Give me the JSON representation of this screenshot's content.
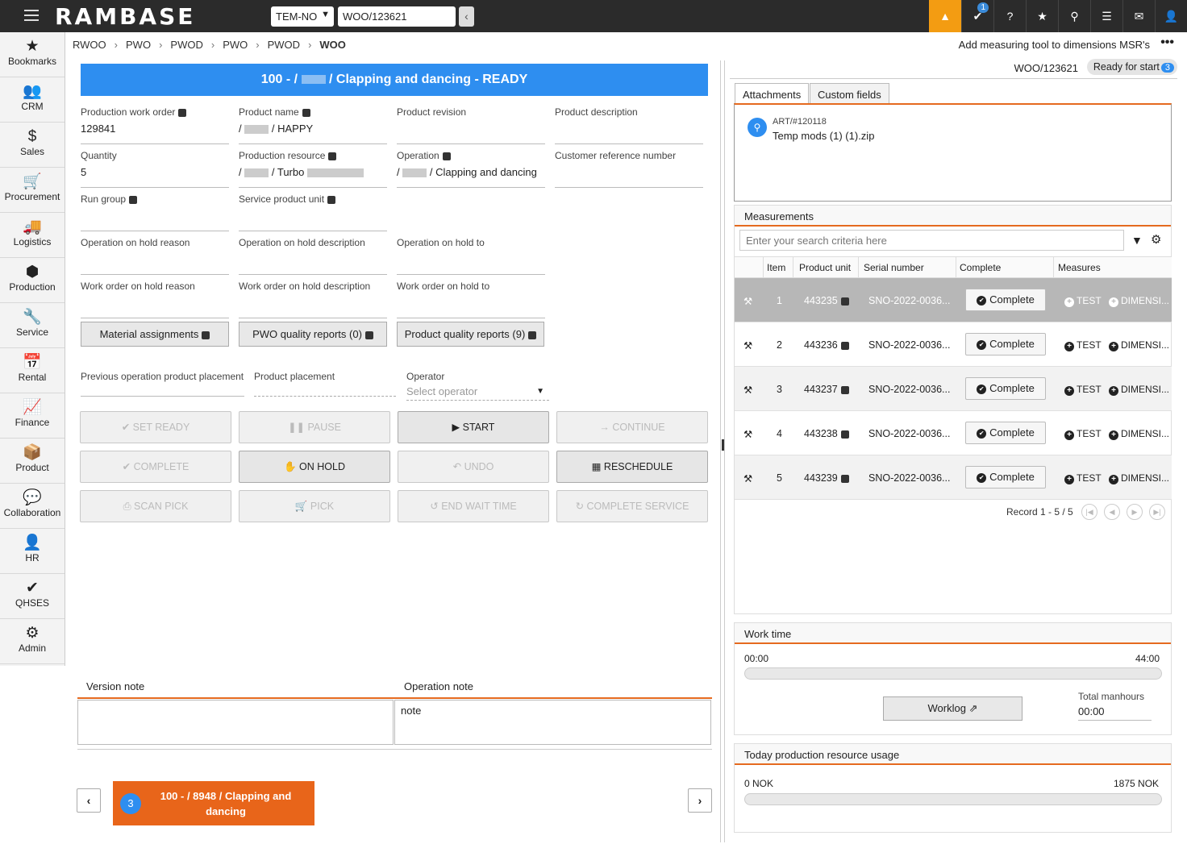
{
  "topbar": {
    "logo": "RAMBASE",
    "company": "TEM-NO",
    "doc_input": "WOO/123621",
    "notif_count": "1"
  },
  "sidebar": [
    {
      "label": "Bookmarks",
      "icon": "star-icon",
      "g": "★"
    },
    {
      "label": "CRM",
      "icon": "people-icon",
      "g": "👥"
    },
    {
      "label": "Sales",
      "icon": "money-bag-icon",
      "g": "$"
    },
    {
      "label": "Procurement",
      "icon": "cart-icon",
      "g": "🛒"
    },
    {
      "label": "Logistics",
      "icon": "truck-icon",
      "g": "🚚"
    },
    {
      "label": "Production",
      "icon": "boxes-icon",
      "g": "⬢"
    },
    {
      "label": "Service",
      "icon": "wrench-icon",
      "g": "🔧"
    },
    {
      "label": "Rental",
      "icon": "calendar-money-icon",
      "g": "📅"
    },
    {
      "label": "Finance",
      "icon": "chart-line-icon",
      "g": "📈"
    },
    {
      "label": "Product",
      "icon": "box-icon",
      "g": "📦"
    },
    {
      "label": "Collaboration",
      "icon": "chat-icon",
      "g": "💬"
    },
    {
      "label": "HR",
      "icon": "person-icon",
      "g": "👤"
    },
    {
      "label": "QHSES",
      "icon": "shield-check-icon",
      "g": "✔"
    },
    {
      "label": "Admin",
      "icon": "gear-icon",
      "g": "⚙"
    }
  ],
  "breadcrumb": [
    "RWOO",
    "PWO",
    "PWOD",
    "PWO",
    "PWOD",
    "WOO"
  ],
  "header_right": "Add measuring tool to dimensions MSR's",
  "banner": {
    "a": "100 - /",
    "b": "/ Clapping and dancing - READY"
  },
  "fields": {
    "pwo_label": "Production work order",
    "pwo_value": "129841",
    "pname_label": "Product name",
    "pname_a": "/",
    "pname_b": "/ HAPPY",
    "prev_label": "Product revision",
    "pdesc_label": "Product description",
    "qty_label": "Quantity",
    "qty_value": "5",
    "pres_label": "Production resource",
    "pres_a": "/",
    "pres_b": "/ Turbo",
    "op_label": "Operation",
    "op_a": "/",
    "op_b": "/ Clapping and dancing",
    "custref_label": "Customer reference number",
    "rungroup_label": "Run group",
    "spu_label": "Service product unit",
    "ohr_label": "Operation on hold reason",
    "ohd_label": "Operation on hold description",
    "oht_label": "Operation on hold to",
    "wohr_label": "Work order on hold reason",
    "wohd_label": "Work order on hold description",
    "woht_label": "Work order on hold to"
  },
  "open_buttons": {
    "material": "Material assignments",
    "pwoq": "PWO quality reports (0)",
    "pq": "Product quality reports (9)"
  },
  "placement": {
    "prev": "Previous operation product placement",
    "prod": "Product placement",
    "operator": "Operator",
    "operator_ph": "Select operator"
  },
  "actions": {
    "set_ready": "SET READY",
    "pause": "PAUSE",
    "start": "START",
    "continue": "CONTINUE",
    "complete": "COMPLETE",
    "on_hold": "ON HOLD",
    "undo": "UNDO",
    "reschedule": "RESCHEDULE",
    "scan_pick": "SCAN PICK",
    "pick": "PICK",
    "end_wait": "END WAIT TIME",
    "complete_service": "COMPLETE SERVICE"
  },
  "notes": {
    "version_label": "Version note",
    "operation_label": "Operation note",
    "operation_value": "note"
  },
  "card": {
    "count": "3",
    "line1": "100 - / 8948 / Clapping and",
    "line2": "dancing"
  },
  "right": {
    "doc": "WOO/123621",
    "status": "Ready for start",
    "status_count": "3"
  },
  "tabs": {
    "attachments": "Attachments",
    "custom": "Custom fields"
  },
  "attachment": {
    "ref": "ART/#120118",
    "name": "Temp mods (1) (1).zip"
  },
  "measurements": {
    "title": "Measurements",
    "search_ph": "Enter your search criteria here",
    "cols": {
      "item": "Item",
      "pu": "Product unit",
      "sn": "Serial number",
      "complete": "Complete",
      "measures": "Measures"
    },
    "rows": [
      {
        "item": "1",
        "pu": "443235",
        "sn": "SNO-2022-0036...",
        "btn": "Complete",
        "m1": "TEST",
        "m2": "DIMENSI..."
      },
      {
        "item": "2",
        "pu": "443236",
        "sn": "SNO-2022-0036...",
        "btn": "Complete",
        "m1": "TEST",
        "m2": "DIMENSI..."
      },
      {
        "item": "3",
        "pu": "443237",
        "sn": "SNO-2022-0036...",
        "btn": "Complete",
        "m1": "TEST",
        "m2": "DIMENSI..."
      },
      {
        "item": "4",
        "pu": "443238",
        "sn": "SNO-2022-0036...",
        "btn": "Complete",
        "m1": "TEST",
        "m2": "DIMENSI..."
      },
      {
        "item": "5",
        "pu": "443239",
        "sn": "SNO-2022-0036...",
        "btn": "Complete",
        "m1": "TEST",
        "m2": "DIMENSI..."
      }
    ],
    "record": "Record 1 - 5 / 5"
  },
  "worktime": {
    "title": "Work time",
    "start": "00:00",
    "end": "44:00",
    "worklog": "Worklog",
    "tm_label": "Total manhours",
    "tm_value": "00:00"
  },
  "usage": {
    "title": "Today production resource usage",
    "min": "0 NOK",
    "max": "1875 NOK"
  },
  "colors": {
    "brand_blue": "#2e8ef0",
    "accent_orange": "#e56a1f",
    "warning": "#f39c12"
  }
}
